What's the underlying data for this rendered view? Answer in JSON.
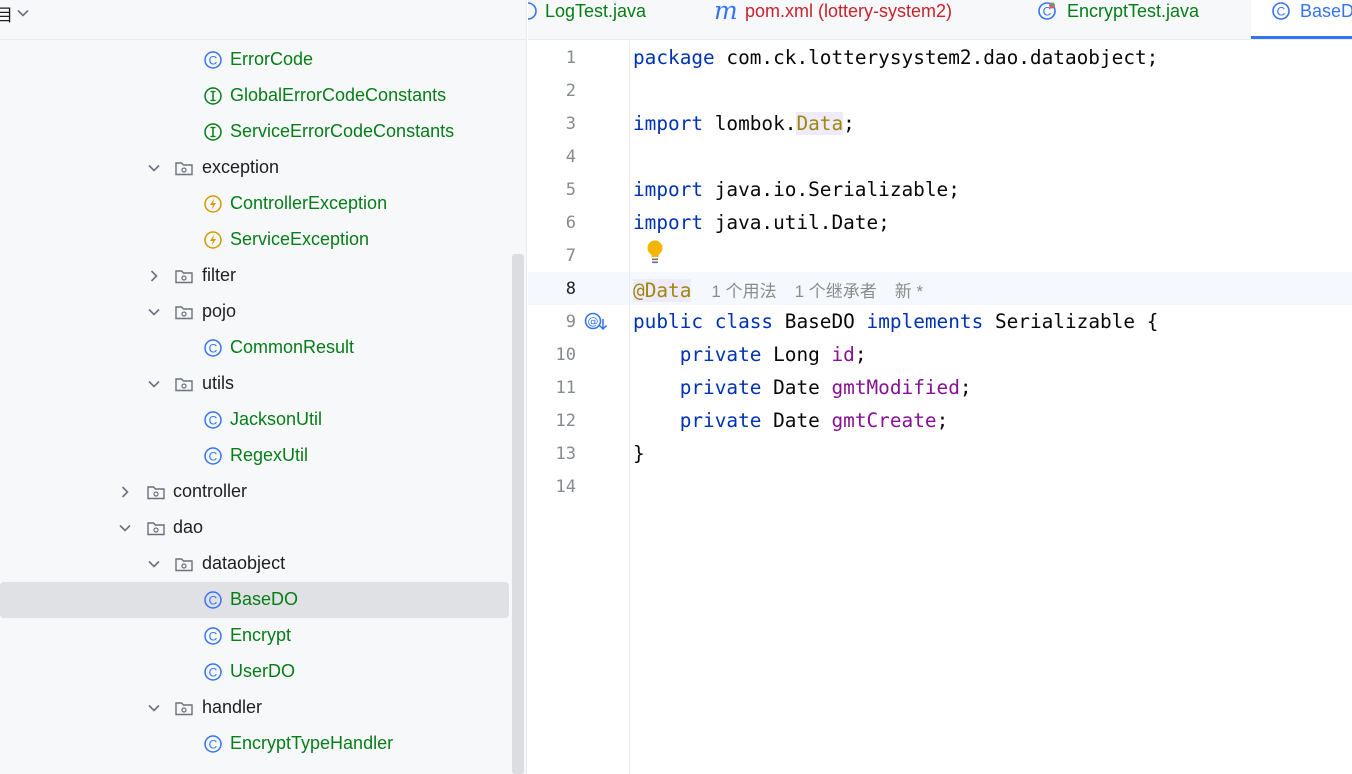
{
  "project_panel": {
    "title": "目"
  },
  "tree": [
    {
      "label": "ErrorCode",
      "kind": "class",
      "icon": "class-icon",
      "indent": 2,
      "expanded": null
    },
    {
      "label": "GlobalErrorCodeConstants",
      "kind": "interface",
      "icon": "interface-icon",
      "indent": 2,
      "expanded": null
    },
    {
      "label": "ServiceErrorCodeConstants",
      "kind": "interface",
      "icon": "interface-icon",
      "indent": 2,
      "expanded": null
    },
    {
      "label": "exception",
      "kind": "folder",
      "icon": "folder-icon",
      "indent": 1,
      "expanded": true
    },
    {
      "label": "ControllerException",
      "kind": "exception",
      "icon": "exception-icon",
      "indent": 2,
      "expanded": null
    },
    {
      "label": "ServiceException",
      "kind": "exception",
      "icon": "exception-icon",
      "indent": 2,
      "expanded": null
    },
    {
      "label": "filter",
      "kind": "folder",
      "icon": "folder-icon",
      "indent": 1,
      "expanded": false
    },
    {
      "label": "pojo",
      "kind": "folder",
      "icon": "folder-icon",
      "indent": 1,
      "expanded": true
    },
    {
      "label": "CommonResult",
      "kind": "class",
      "icon": "class-icon",
      "indent": 2,
      "expanded": null
    },
    {
      "label": "utils",
      "kind": "folder",
      "icon": "folder-icon",
      "indent": 1,
      "expanded": true
    },
    {
      "label": "JacksonUtil",
      "kind": "class",
      "icon": "class-icon",
      "indent": 2,
      "expanded": null
    },
    {
      "label": "RegexUtil",
      "kind": "class",
      "icon": "class-icon",
      "indent": 2,
      "expanded": null
    },
    {
      "label": "controller",
      "kind": "folder",
      "icon": "folder-icon",
      "indent": 0,
      "expanded": false
    },
    {
      "label": "dao",
      "kind": "folder",
      "icon": "folder-icon",
      "indent": 0,
      "expanded": true
    },
    {
      "label": "dataobject",
      "kind": "folder",
      "icon": "folder-icon",
      "indent": 1,
      "expanded": true
    },
    {
      "label": "BaseDO",
      "kind": "class",
      "icon": "class-icon",
      "indent": 2,
      "expanded": null,
      "selected": true
    },
    {
      "label": "Encrypt",
      "kind": "class",
      "icon": "class-icon",
      "indent": 2,
      "expanded": null
    },
    {
      "label": "UserDO",
      "kind": "class",
      "icon": "class-icon",
      "indent": 2,
      "expanded": null
    },
    {
      "label": "handler",
      "kind": "folder",
      "icon": "folder-icon",
      "indent": 1,
      "expanded": true
    },
    {
      "label": "EncryptTypeHandler",
      "kind": "class",
      "icon": "class-icon",
      "indent": 2,
      "expanded": null
    },
    {
      "label": "",
      "kind": "folder",
      "icon": "folder-icon",
      "indent": 1,
      "expanded": null
    }
  ],
  "tabs": [
    {
      "label": "LogTest.java",
      "icon": "java-test-icon",
      "color": "#067d17",
      "active": false
    },
    {
      "label": "pom.xml (lottery-system2)",
      "icon": "maven-m-icon",
      "color": "#c7222d",
      "active": false
    },
    {
      "label": "EncryptTest.java",
      "icon": "test-class-icon",
      "color": "#067d17",
      "active": false
    },
    {
      "label": "BaseD",
      "icon": "class-icon",
      "color": "#3574f0",
      "active": true
    }
  ],
  "editor": {
    "line_numbers": [
      "1",
      "2",
      "3",
      "4",
      "5",
      "6",
      "7",
      "8",
      "9",
      "10",
      "11",
      "12",
      "13",
      "14"
    ],
    "current_line": "8",
    "code": {
      "l1": {
        "kw": "package",
        "rest": " com.ck.lotterysystem2.dao.dataobject;"
      },
      "l3": {
        "kw": "import",
        "pre": " lombok.",
        "ann": "Data",
        "post": ";"
      },
      "l5": {
        "kw": "import",
        "rest": " java.io.Serializable;"
      },
      "l6": {
        "kw": "import",
        "rest": " java.util.Date;"
      },
      "l8": {
        "at": "@",
        "ann": "Data",
        "usages": "1 个用法",
        "inheritors": "1 个继承者",
        "new_marker": "新 *"
      },
      "l9": {
        "kw1": "public",
        "kw2": "class",
        "name": " BaseDO ",
        "kw3": "implements",
        "rest": " Serializable {"
      },
      "l10": {
        "kw": "private",
        "type": " Long ",
        "field": "id",
        "end": ";"
      },
      "l11": {
        "kw": "private",
        "type": " Date ",
        "field": "gmtModified",
        "end": ";"
      },
      "l12": {
        "kw": "private",
        "type": " Date ",
        "field": "gmtCreate",
        "end": ";"
      },
      "l13": {
        "rest": "}"
      }
    }
  },
  "colors": {
    "accent": "#3574f0",
    "class_text": "#067d17",
    "keyword": "#0033b3",
    "annotation": "#9e880d",
    "field": "#871094",
    "bulb": "#f2b600"
  }
}
